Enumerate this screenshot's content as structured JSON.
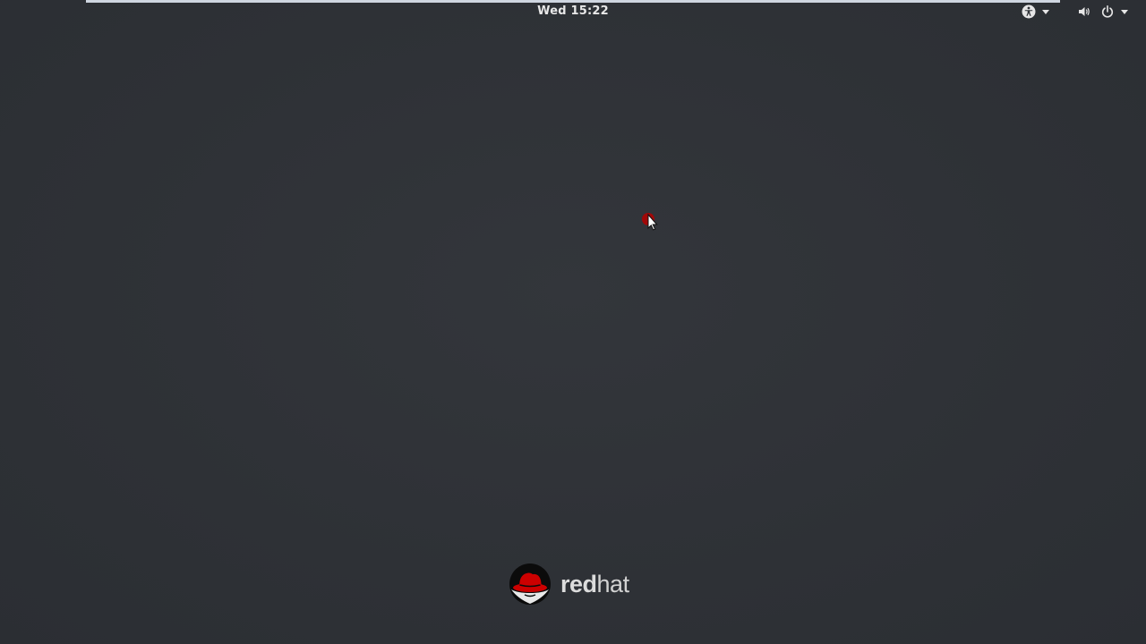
{
  "top_bar": {
    "clock": "Wed 15:22",
    "accessibility_icon": "accessibility-icon",
    "volume_icon": "volume-icon",
    "power_icon": "power-icon"
  },
  "desktop": {
    "cursor_icon": "mouse-pointer-icon"
  },
  "brand": {
    "name_part1": "red",
    "name_part2": "hat",
    "logo_icon": "redhat-shadowman-icon",
    "accent_color": "#cc0000"
  }
}
